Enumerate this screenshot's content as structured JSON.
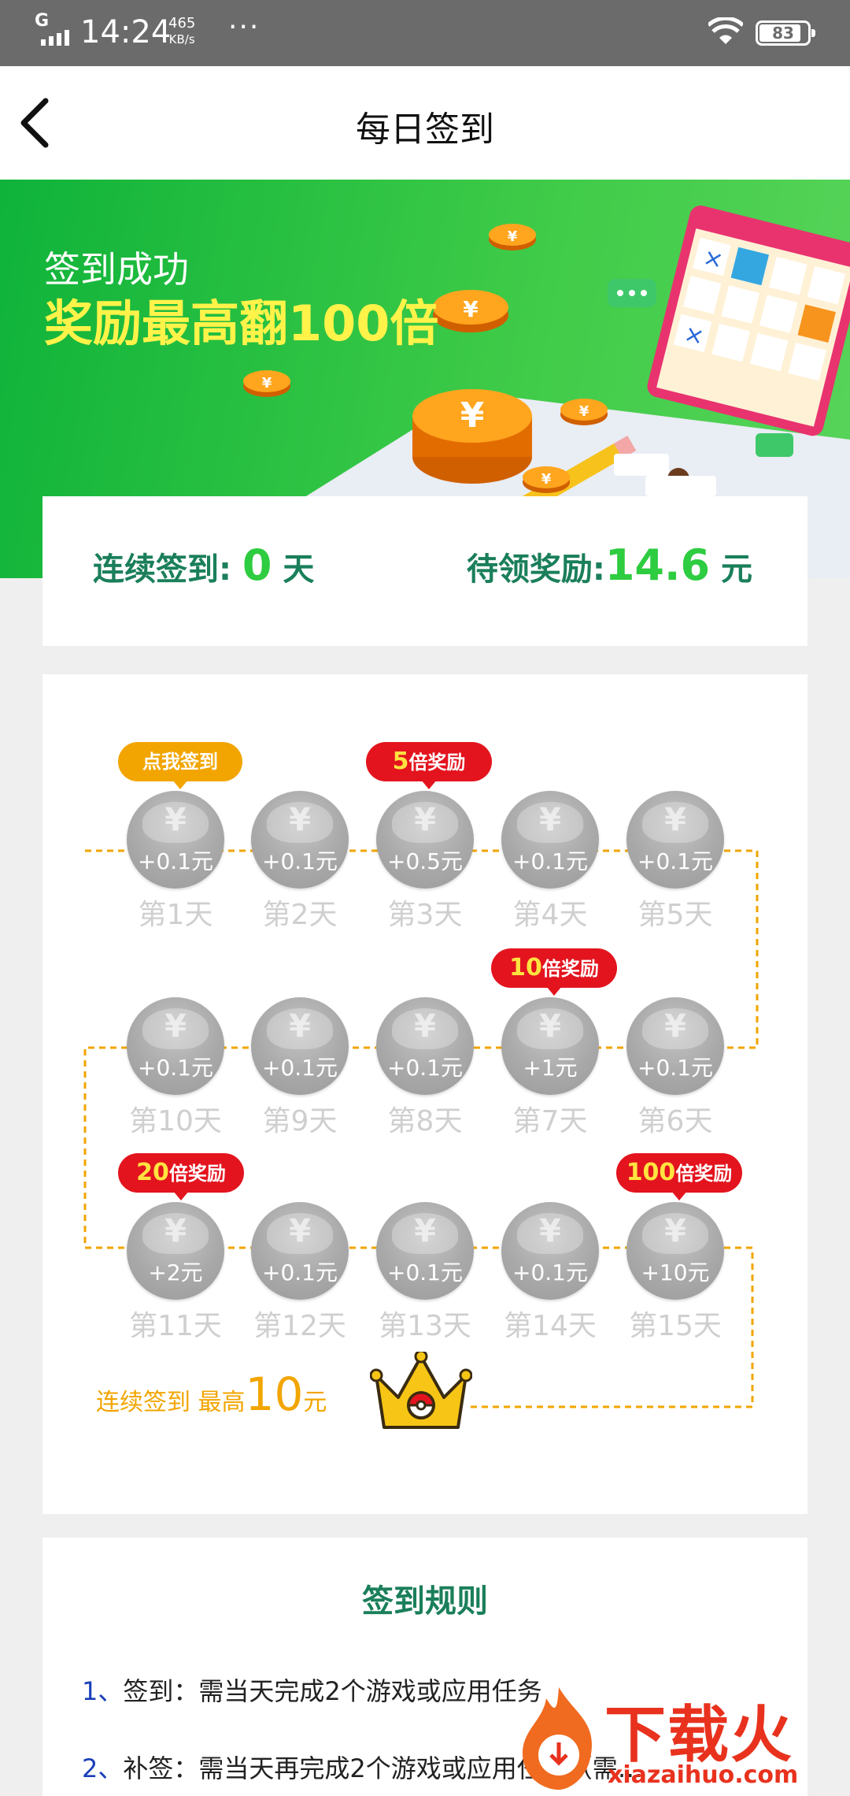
{
  "status_bar": {
    "network": "G",
    "time": "14:24",
    "speed_value": "465",
    "speed_unit": "KB/s",
    "dots": "···",
    "battery": "83"
  },
  "header": {
    "title": "每日签到"
  },
  "banner": {
    "line1": "签到成功",
    "line2": "奖励最高翻100倍"
  },
  "summary": {
    "streak_label": "连续签到: ",
    "streak_value": "0",
    "streak_unit": " 天",
    "reward_label": "待领奖励:",
    "reward_value": "14.6",
    "reward_unit": " 元"
  },
  "calendar": {
    "days": [
      {
        "label": "第1天",
        "amount": "+0.1元"
      },
      {
        "label": "第2天",
        "amount": "+0.1元"
      },
      {
        "label": "第3天",
        "amount": "+0.5元"
      },
      {
        "label": "第4天",
        "amount": "+0.1元"
      },
      {
        "label": "第5天",
        "amount": "+0.1元"
      },
      {
        "label": "第6天",
        "amount": "+0.1元"
      },
      {
        "label": "第7天",
        "amount": "+1元"
      },
      {
        "label": "第8天",
        "amount": "+0.1元"
      },
      {
        "label": "第9天",
        "amount": "+0.1元"
      },
      {
        "label": "第10天",
        "amount": "+0.1元"
      },
      {
        "label": "第11天",
        "amount": "+2元"
      },
      {
        "label": "第12天",
        "amount": "+0.1元"
      },
      {
        "label": "第13天",
        "amount": "+0.1元"
      },
      {
        "label": "第14天",
        "amount": "+0.1元"
      },
      {
        "label": "第15天",
        "amount": "+10元"
      }
    ],
    "yen": "¥",
    "tags": {
      "sign_in": "点我签到",
      "x5_num": "5",
      "x10_num": "10",
      "x20_num": "20",
      "x100_num": "100",
      "suffix": "倍奖励"
    },
    "streak_text": "连续签到 最高",
    "streak_max": "10",
    "streak_unit": "元"
  },
  "rules": {
    "title": "签到规则",
    "items": [
      {
        "num": "1、",
        "text": "签到：需当天完成2个游戏或应用任务"
      },
      {
        "num": "2、",
        "text": "补签：需当天再完成2个游戏或应用任务（需…"
      }
    ]
  },
  "watermark": {
    "text": "下载火",
    "url": "xiazaihuo.com"
  },
  "colors": {
    "brand_green": "#2ecc40",
    "title_teal": "#1a7f5a",
    "tag_red": "#e3141e",
    "tag_orange": "#f2a500"
  }
}
